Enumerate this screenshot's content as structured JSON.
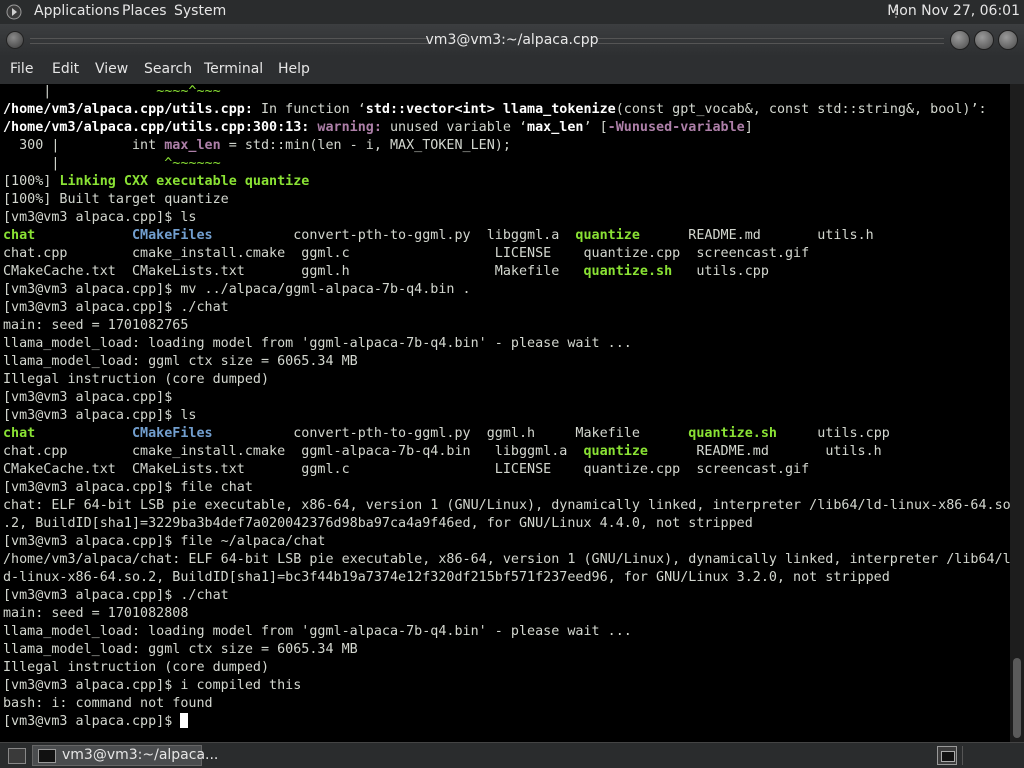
{
  "topbar": {
    "menus": [
      "Applications",
      "Places",
      "System"
    ],
    "clock": "Mon Nov 27, 06:01"
  },
  "window": {
    "title": "vm3@vm3:~/alpaca.cpp"
  },
  "menubar": {
    "items": [
      "File",
      "Edit",
      "View",
      "Search",
      "Terminal",
      "Help"
    ]
  },
  "terminal": {
    "lines": [
      [
        {
          "t": "     |             "
        },
        {
          "t": "~~~~^~~~",
          "c": "gn"
        }
      ],
      [
        {
          "t": "/home/vm3/alpaca.cpp/utils.cpp:",
          "c": "b"
        },
        {
          "t": " In function ‘"
        },
        {
          "t": "std::vector<int> llama_tokenize",
          "c": "b"
        },
        {
          "t": "(const gpt_vocab&, const std::string&, bool)’:"
        }
      ],
      [
        {
          "t": "/home/vm3/alpaca.cpp/utils.cpp:300:13:",
          "c": "b"
        },
        {
          "t": " "
        },
        {
          "t": "warning:",
          "c": "m"
        },
        {
          "t": " unused variable ‘"
        },
        {
          "t": "max_len",
          "c": "b"
        },
        {
          "t": "’ ["
        },
        {
          "t": "-Wunused-variable",
          "c": "m"
        },
        {
          "t": "]"
        }
      ],
      [
        {
          "t": "  300 |         int "
        },
        {
          "t": "max_len",
          "c": "m"
        },
        {
          "t": " = std::min(len - i, MAX_TOKEN_LEN);"
        }
      ],
      [
        {
          "t": "      |             "
        },
        {
          "t": "^~~~~~~",
          "c": "gn"
        }
      ],
      [
        {
          "t": "[100%] "
        },
        {
          "t": "Linking CXX executable quantize",
          "c": "g"
        }
      ],
      [
        {
          "t": "[100%] Built target quantize"
        }
      ],
      [
        {
          "t": "[vm3@vm3 alpaca.cpp]$ ls"
        }
      ],
      [
        {
          "t": "chat",
          "c": "g"
        },
        {
          "t": "            "
        },
        {
          "t": "CMakeFiles",
          "c": "bl"
        },
        {
          "t": "          convert-pth-to-ggml.py  libggml.a  "
        },
        {
          "t": "quantize",
          "c": "g"
        },
        {
          "t": "      README.md       utils.h"
        }
      ],
      [
        {
          "t": "chat.cpp        cmake_install.cmake  ggml.c                  LICENSE    quantize.cpp  screencast.gif"
        }
      ],
      [
        {
          "t": "CMakeCache.txt  CMakeLists.txt       ggml.h                  Makefile   "
        },
        {
          "t": "quantize.sh",
          "c": "g"
        },
        {
          "t": "   utils.cpp"
        }
      ],
      [
        {
          "t": "[vm3@vm3 alpaca.cpp]$ mv ../alpaca/ggml-alpaca-7b-q4.bin ."
        }
      ],
      [
        {
          "t": "[vm3@vm3 alpaca.cpp]$ ./chat"
        }
      ],
      [
        {
          "t": "main: seed = 1701082765"
        }
      ],
      [
        {
          "t": "llama_model_load: loading model from 'ggml-alpaca-7b-q4.bin' - please wait ..."
        }
      ],
      [
        {
          "t": "llama_model_load: ggml ctx size = 6065.34 MB"
        }
      ],
      [
        {
          "t": "Illegal instruction (core dumped)"
        }
      ],
      [
        {
          "t": "[vm3@vm3 alpaca.cpp]$"
        }
      ],
      [
        {
          "t": "[vm3@vm3 alpaca.cpp]$ ls"
        }
      ],
      [
        {
          "t": "chat",
          "c": "g"
        },
        {
          "t": "            "
        },
        {
          "t": "CMakeFiles",
          "c": "bl"
        },
        {
          "t": "          convert-pth-to-ggml.py  ggml.h     Makefile      "
        },
        {
          "t": "quantize.sh",
          "c": "g"
        },
        {
          "t": "     utils.cpp"
        }
      ],
      [
        {
          "t": "chat.cpp        cmake_install.cmake  ggml-alpaca-7b-q4.bin   libggml.a  "
        },
        {
          "t": "quantize",
          "c": "g"
        },
        {
          "t": "      README.md       utils.h"
        }
      ],
      [
        {
          "t": "CMakeCache.txt  CMakeLists.txt       ggml.c                  LICENSE    quantize.cpp  screencast.gif"
        }
      ],
      [
        {
          "t": "[vm3@vm3 alpaca.cpp]$ file chat"
        }
      ],
      [
        {
          "t": "chat: ELF 64-bit LSB pie executable, x86-64, version 1 (GNU/Linux), dynamically linked, interpreter /lib64/ld-linux-x86-64.so"
        }
      ],
      [
        {
          "t": ".2, BuildID[sha1]=3229ba3b4def7a020042376d98ba97ca4a9f46ed, for GNU/Linux 4.4.0, not stripped"
        }
      ],
      [
        {
          "t": "[vm3@vm3 alpaca.cpp]$ file ~/alpaca/chat"
        }
      ],
      [
        {
          "t": "/home/vm3/alpaca/chat: ELF 64-bit LSB pie executable, x86-64, version 1 (GNU/Linux), dynamically linked, interpreter /lib64/l"
        }
      ],
      [
        {
          "t": "d-linux-x86-64.so.2, BuildID[sha1]=bc3f44b19a7374e12f320df215bf571f237eed96, for GNU/Linux 3.2.0, not stripped"
        }
      ],
      [
        {
          "t": "[vm3@vm3 alpaca.cpp]$ ./chat"
        }
      ],
      [
        {
          "t": "main: seed = 1701082808"
        }
      ],
      [
        {
          "t": "llama_model_load: loading model from 'ggml-alpaca-7b-q4.bin' - please wait ..."
        }
      ],
      [
        {
          "t": "llama_model_load: ggml ctx size = 6065.34 MB"
        }
      ],
      [
        {
          "t": "Illegal instruction (core dumped)"
        }
      ],
      [
        {
          "t": "[vm3@vm3 alpaca.cpp]$ i compiled this"
        }
      ],
      [
        {
          "t": "bash: i: command not found"
        }
      ],
      [
        {
          "t": "[vm3@vm3 alpaca.cpp]$ "
        }
      ]
    ]
  },
  "taskbar": {
    "task_label": "vm3@vm3:~/alpaca..."
  }
}
